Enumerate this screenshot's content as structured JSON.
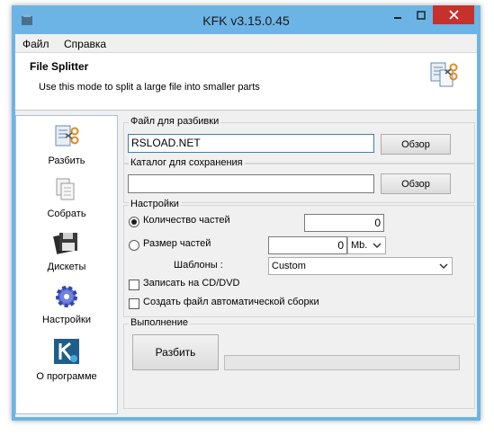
{
  "window": {
    "title": "KFK v3.15.0.45"
  },
  "menu": {
    "file": "Файл",
    "help": "Справка"
  },
  "header": {
    "title": "File Splitter",
    "description": "Use this mode to split a large file into smaller parts"
  },
  "sidebar": {
    "items": [
      {
        "label": "Разбить",
        "icon": "scissors-icon"
      },
      {
        "label": "Собрать",
        "icon": "documents-icon"
      },
      {
        "label": "Дискеты",
        "icon": "floppy-icon"
      },
      {
        "label": "Настройки",
        "icon": "gear-icon"
      },
      {
        "label": "О программе",
        "icon": "kfk-logo-icon"
      }
    ]
  },
  "split_file": {
    "label": "Файл для разбивки",
    "value": "RSLOAD.NET",
    "browse": "Обзор"
  },
  "save_dir": {
    "label": "Каталог для сохранения",
    "value": "",
    "browse": "Обзор"
  },
  "settings": {
    "label": "Настройки",
    "parts_count_label": "Количество частей",
    "parts_count_value": "0",
    "parts_size_label": "Размер частей",
    "parts_size_value": "0",
    "unit": "Mb.",
    "templates_label": "Шаблоны :",
    "template_value": "Custom",
    "write_cd_label": "Записать на CD/DVD",
    "create_autobuild_label": "Создать файл автоматической сборки"
  },
  "execution": {
    "label": "Выполнение",
    "split_button": "Разбить",
    "progress": 0
  }
}
